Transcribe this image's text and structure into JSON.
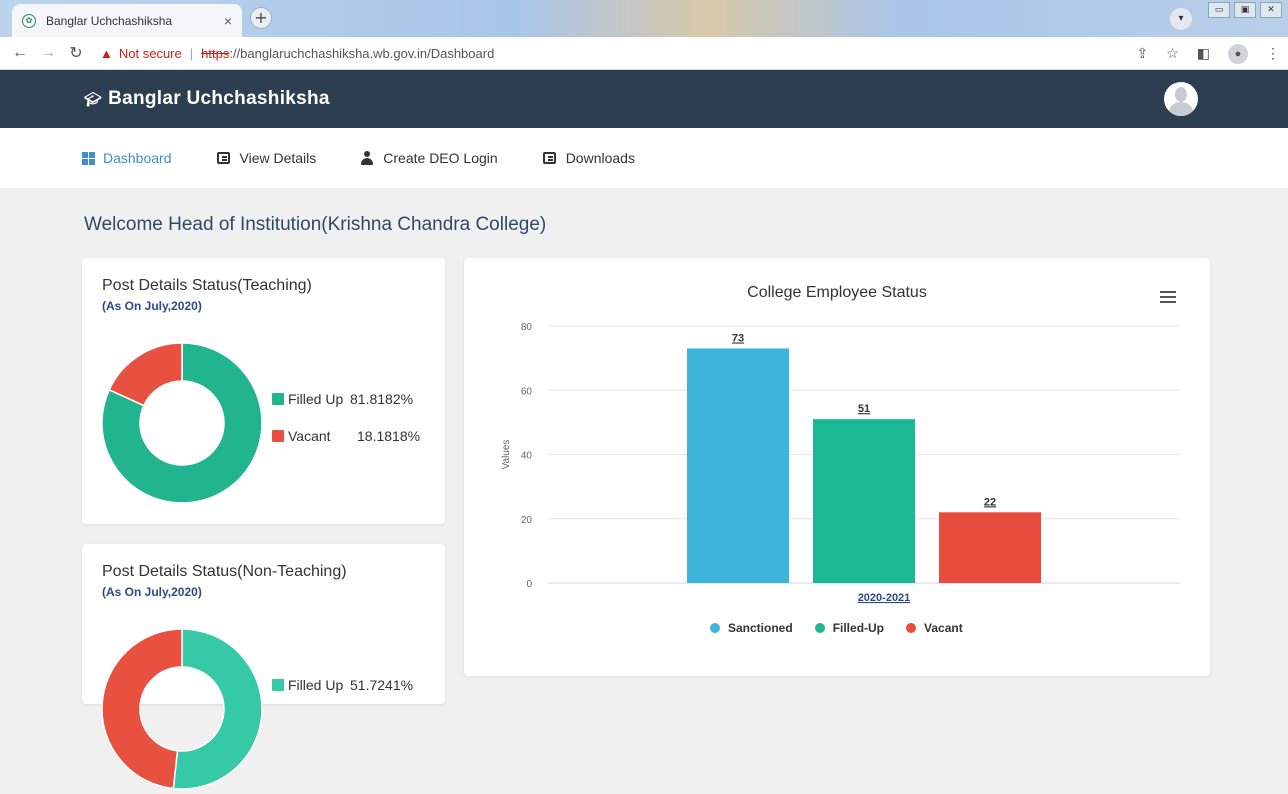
{
  "browser": {
    "tab_title": "Banglar Uchchashiksha",
    "tab_close": "×",
    "new_tab": "+",
    "not_secure": "Not secure",
    "url_scheme": "https",
    "url_rest": "://banglaruchchashiksha.wb.gov.in/Dashboard"
  },
  "header": {
    "brand": "Banglar Uchchashiksha"
  },
  "menu": {
    "items": [
      {
        "label": "Dashboard",
        "active": true
      },
      {
        "label": "View Details"
      },
      {
        "label": "Create DEO Login"
      },
      {
        "label": "Downloads"
      }
    ]
  },
  "welcome": "Welcome Head of Institution(Krishna Chandra College)",
  "teaching": {
    "title": "Post Details Status(Teaching)",
    "subtitle": "(As On July,2020)",
    "legend": [
      {
        "label": "Filled Up",
        "value": "81.8182%",
        "color": "#22b48f"
      },
      {
        "label": "Vacant",
        "value": "18.1818%",
        "color": "#e8503f"
      }
    ]
  },
  "nonteaching": {
    "title": "Post Details Status(Non-Teaching)",
    "subtitle": "(As On July,2020)",
    "legend": [
      {
        "label": "Filled Up",
        "value": "51.7241%",
        "color": "#36c9a8"
      }
    ]
  },
  "chart_data": [
    {
      "type": "pie",
      "categories": [
        "Filled Up",
        "Vacant"
      ],
      "values": [
        81.8182,
        18.1818
      ],
      "title": "Post Details Status(Teaching)"
    },
    {
      "type": "pie",
      "categories": [
        "Filled Up",
        "Vacant"
      ],
      "values": [
        51.7241,
        48.2759
      ],
      "title": "Post Details Status(Non-Teaching)"
    },
    {
      "type": "bar",
      "title": "College Employee Status",
      "categories": [
        "2020-2021"
      ],
      "series": [
        {
          "name": "Sanctioned",
          "values": [
            73
          ],
          "color": "#3cb4dc"
        },
        {
          "name": "Filled-Up",
          "values": [
            51
          ],
          "color": "#1bb894"
        },
        {
          "name": "Vacant",
          "values": [
            22
          ],
          "color": "#e74c3c"
        }
      ],
      "ylabel": "Values",
      "ylim": [
        0,
        80
      ],
      "yticks": [
        0,
        20,
        40,
        60,
        80
      ],
      "grid": true,
      "legend": "bottom"
    }
  ]
}
